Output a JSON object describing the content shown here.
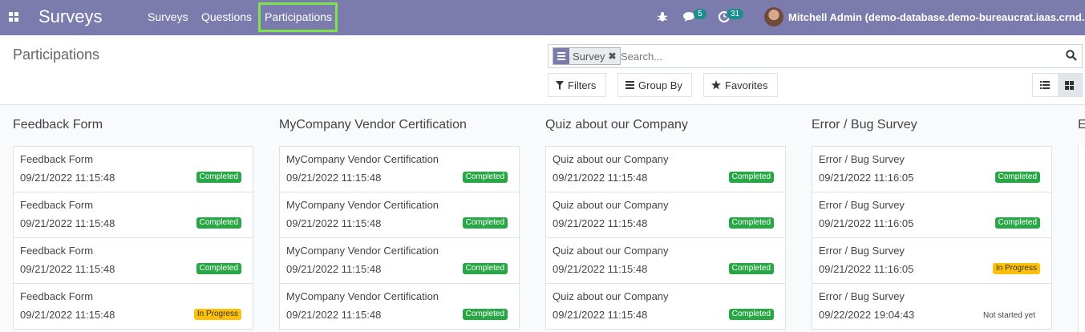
{
  "app": {
    "brand": "Surveys",
    "menu": [
      "Surveys",
      "Questions",
      "Participations"
    ],
    "active_menu": "Participations",
    "messages_count": "5",
    "activities_count": "31",
    "user": "Mitchell Admin (demo-database.demo-bureaucrat.iaas.crnd.pro)"
  },
  "control_panel": {
    "title": "Participations",
    "facet_label": "Survey",
    "search_placeholder": "Search...",
    "filters_label": "Filters",
    "groupby_label": "Group By",
    "favorites_label": "Favorites"
  },
  "kanban": {
    "columns": [
      {
        "title": "Feedback Form",
        "cards": [
          {
            "name": "Feedback Form",
            "date": "09/21/2022 11:15:48",
            "state": "Completed"
          },
          {
            "name": "Feedback Form",
            "date": "09/21/2022 11:15:48",
            "state": "Completed"
          },
          {
            "name": "Feedback Form",
            "date": "09/21/2022 11:15:48",
            "state": "Completed"
          },
          {
            "name": "Feedback Form",
            "date": "09/21/2022 11:15:48",
            "state": "In Progress"
          }
        ]
      },
      {
        "title": "MyCompany Vendor Certification",
        "cards": [
          {
            "name": "MyCompany Vendor Certification",
            "date": "09/21/2022 11:15:48",
            "state": "Completed"
          },
          {
            "name": "MyCompany Vendor Certification",
            "date": "09/21/2022 11:15:48",
            "state": "Completed"
          },
          {
            "name": "MyCompany Vendor Certification",
            "date": "09/21/2022 11:15:48",
            "state": "Completed"
          },
          {
            "name": "MyCompany Vendor Certification",
            "date": "09/21/2022 11:15:48",
            "state": "Completed"
          }
        ]
      },
      {
        "title": "Quiz about our Company",
        "cards": [
          {
            "name": "Quiz about our Company",
            "date": "09/21/2022 11:15:48",
            "state": "Completed"
          },
          {
            "name": "Quiz about our Company",
            "date": "09/21/2022 11:15:48",
            "state": "Completed"
          },
          {
            "name": "Quiz about our Company",
            "date": "09/21/2022 11:15:48",
            "state": "Completed"
          },
          {
            "name": "Quiz about our Company",
            "date": "09/21/2022 11:15:48",
            "state": "Completed"
          }
        ]
      },
      {
        "title": "Error / Bug Survey",
        "cards": [
          {
            "name": "Error / Bug Survey",
            "date": "09/21/2022 11:16:05",
            "state": "Completed"
          },
          {
            "name": "Error / Bug Survey",
            "date": "09/21/2022 11:16:05",
            "state": "Completed"
          },
          {
            "name": "Error / Bug Survey",
            "date": "09/21/2022 11:16:05",
            "state": "In Progress"
          },
          {
            "name": "Error / Bug Survey",
            "date": "09/22/2022 19:04:43",
            "state": "Not started yet"
          }
        ]
      }
    ],
    "partial_column_title": "E"
  },
  "colors": {
    "navbar": "#7c7bad",
    "active_highlight": "#7ee24a",
    "completed": "#28a745",
    "in_progress": "#ffc107"
  }
}
